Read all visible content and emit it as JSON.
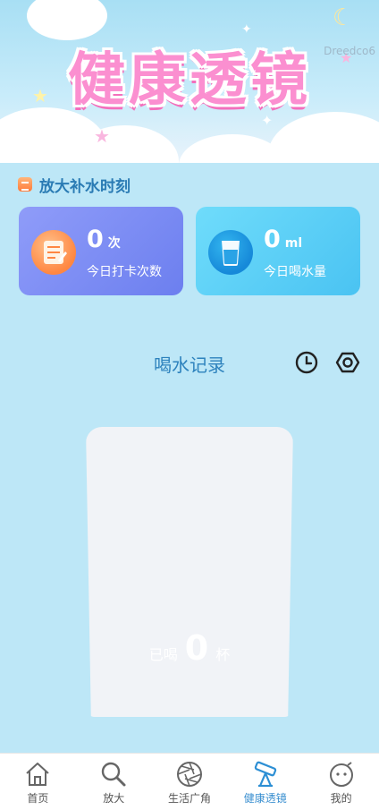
{
  "banner": {
    "title": "健康透镜",
    "watermark": "Dreedco6"
  },
  "section": {
    "title": "放大补水时刻",
    "icon": "calendar-icon"
  },
  "cards": {
    "checkin": {
      "value": "0",
      "unit": "次",
      "label": "今日打卡次数",
      "icon": "notepad-icon"
    },
    "water": {
      "value": "0",
      "unit": "ml",
      "label": "今日喝水量",
      "icon": "water-glass-icon"
    }
  },
  "record": {
    "title": "喝水记录",
    "history_icon": "clock-icon",
    "settings_icon": "gear-icon"
  },
  "cup": {
    "prefix": "已喝",
    "count": "0",
    "suffix": "杯"
  },
  "tabbar": {
    "items": [
      {
        "label": "首页",
        "icon": "home-icon"
      },
      {
        "label": "放大",
        "icon": "magnifier-icon"
      },
      {
        "label": "生活广角",
        "icon": "aperture-icon"
      },
      {
        "label": "健康透镜",
        "icon": "telescope-icon"
      },
      {
        "label": "我的",
        "icon": "face-icon"
      }
    ],
    "active_index": 3
  },
  "colors": {
    "background": "#bde7f7",
    "accent": "#2d82bd",
    "active_tab": "#3a8fd0",
    "checkin_card": "#7d8df4",
    "water_card": "#5ccff6"
  }
}
